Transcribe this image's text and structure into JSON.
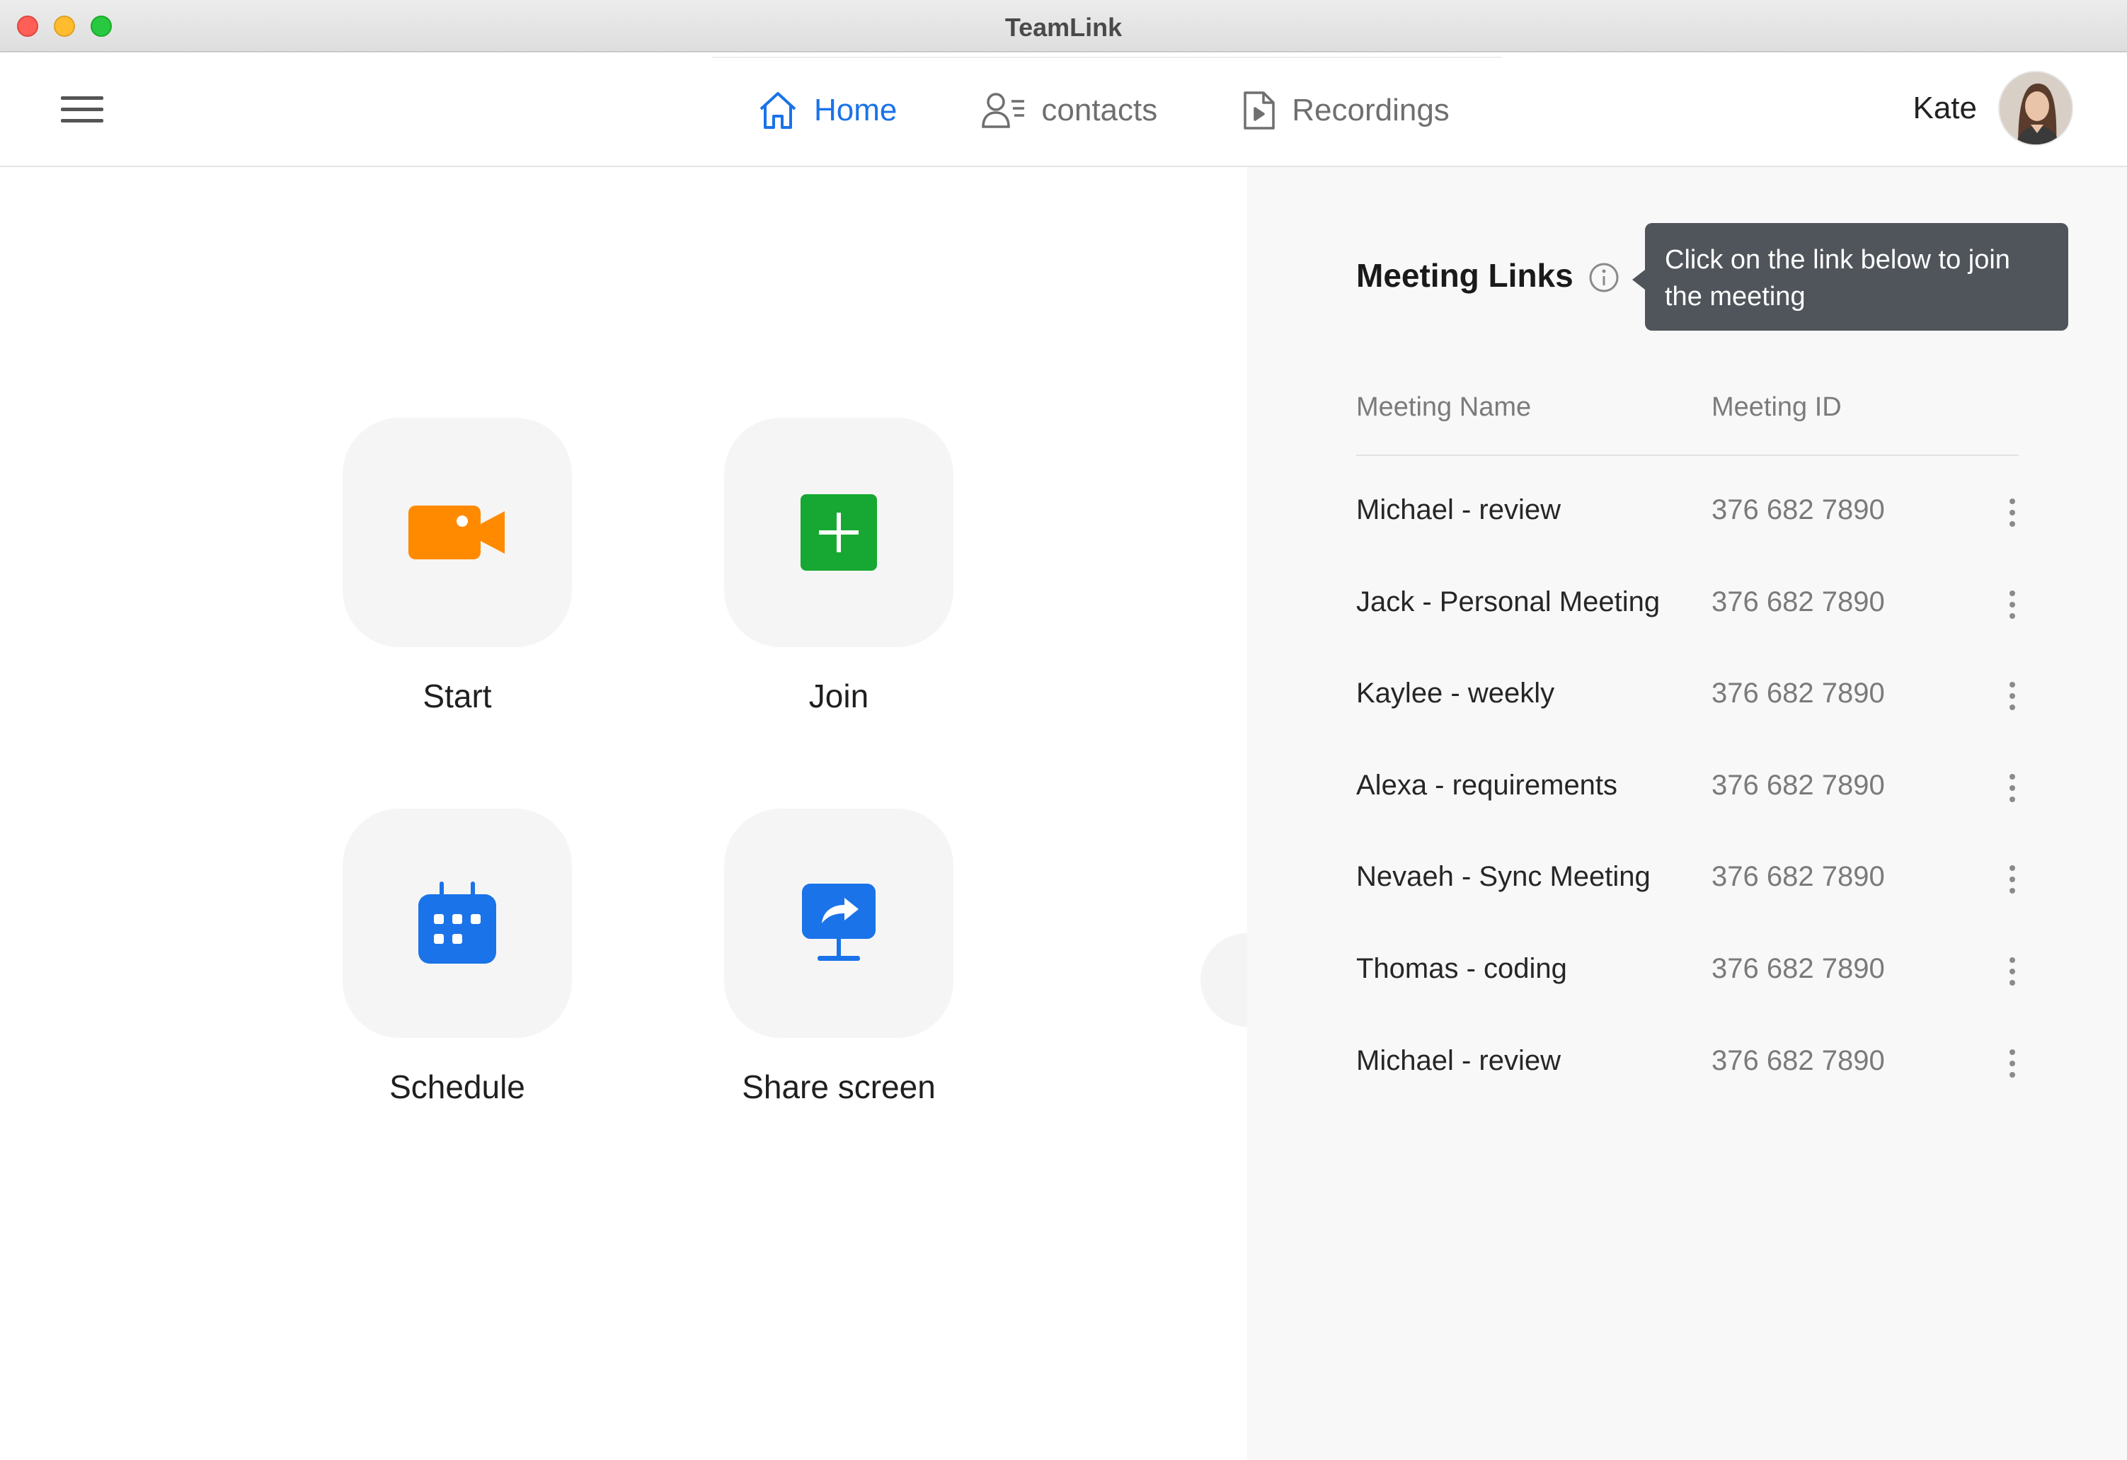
{
  "window": {
    "title": "TeamLink"
  },
  "header": {
    "tabs": [
      {
        "label": "Home",
        "icon": "home-icon",
        "active": true
      },
      {
        "label": "contacts",
        "icon": "contacts-icon",
        "active": false
      },
      {
        "label": "Recordings",
        "icon": "recordings-icon",
        "active": false
      }
    ],
    "user": {
      "name": "Kate"
    }
  },
  "actions": [
    {
      "label": "Start",
      "icon": "video-camera-icon",
      "color": "#ff8a00"
    },
    {
      "label": "Join",
      "icon": "plus-icon",
      "color": "#16a832"
    },
    {
      "label": "Schedule",
      "icon": "calendar-icon",
      "color": "#1a73e8"
    },
    {
      "label": "Share screen",
      "icon": "share-screen-icon",
      "color": "#1a73e8"
    }
  ],
  "meeting_links": {
    "title": "Meeting Links",
    "tooltip": "Click on the link below to join the meeting",
    "columns": {
      "name": "Meeting Name",
      "id": "Meeting ID"
    },
    "rows": [
      {
        "name": "Michael - review",
        "id": "376 682 7890"
      },
      {
        "name": "Jack - Personal Meeting",
        "id": "376 682 7890"
      },
      {
        "name": "Kaylee - weekly",
        "id": "376 682 7890"
      },
      {
        "name": "Alexa - requirements",
        "id": "376 682 7890"
      },
      {
        "name": "Nevaeh - Sync Meeting",
        "id": "376 682 7890"
      },
      {
        "name": "Thomas - coding",
        "id": "376 682 7890"
      },
      {
        "name": "Michael - review",
        "id": "376 682 7890"
      }
    ]
  },
  "colors": {
    "accent": "#1a73e8",
    "start": "#ff8a00",
    "join": "#16a832",
    "tooltip_bg": "#50555b"
  }
}
